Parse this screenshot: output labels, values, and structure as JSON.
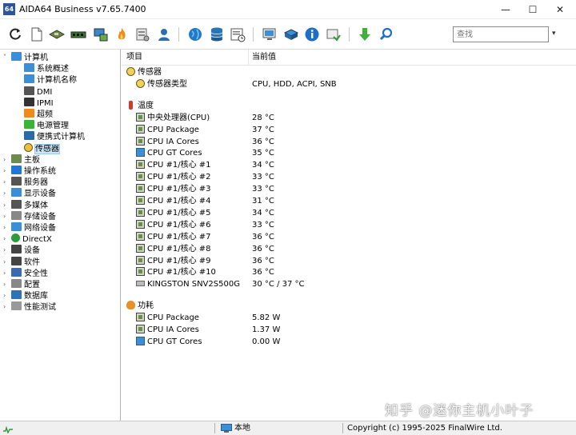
{
  "window": {
    "app_icon_text": "64",
    "title": "AIDA64 Business v7.65.7400",
    "min_glyph": "—",
    "max_glyph": "☐",
    "close_glyph": "✕"
  },
  "toolbar": {
    "icons": [
      "refresh-icon",
      "report-icon",
      "motherboard-icon",
      "memory-icon",
      "network-icon",
      "flame-icon",
      "benchmark-icon",
      "user-icon",
      "globe-icon",
      "database-icon",
      "schedule-icon",
      "monitor-diagnostics-icon",
      "network-audit-icon",
      "info-icon",
      "cpuid-icon",
      "download-icon",
      "search-icon"
    ],
    "search_placeholder": "查找",
    "search_value": "",
    "dropdown_glyph": "▾"
  },
  "tree": {
    "items": [
      {
        "label": "计算机",
        "depth": 0,
        "expand": "open",
        "icon": "computer-icon"
      },
      {
        "label": "系统概述",
        "depth": 1,
        "expand": "",
        "icon": "monitor-icon"
      },
      {
        "label": "计算机名称",
        "depth": 1,
        "expand": "",
        "icon": "monitor-icon"
      },
      {
        "label": "DMI",
        "depth": 1,
        "expand": "",
        "icon": "dmi-icon"
      },
      {
        "label": "IPMI",
        "depth": 1,
        "expand": "",
        "icon": "ipmi-icon"
      },
      {
        "label": "超频",
        "depth": 1,
        "expand": "",
        "icon": "flame-icon"
      },
      {
        "label": "电源管理",
        "depth": 1,
        "expand": "",
        "icon": "power-icon"
      },
      {
        "label": "便携式计算机",
        "depth": 1,
        "expand": "",
        "icon": "laptop-icon"
      },
      {
        "label": "传感器",
        "depth": 1,
        "expand": "",
        "icon": "sensor-icon",
        "selected": true
      },
      {
        "label": "主板",
        "depth": 0,
        "expand": "closed",
        "icon": "motherboard-icon"
      },
      {
        "label": "操作系统",
        "depth": 0,
        "expand": "closed",
        "icon": "windows-icon"
      },
      {
        "label": "服务器",
        "depth": 0,
        "expand": "closed",
        "icon": "server-icon"
      },
      {
        "label": "显示设备",
        "depth": 0,
        "expand": "closed",
        "icon": "display-icon"
      },
      {
        "label": "多媒体",
        "depth": 0,
        "expand": "closed",
        "icon": "speaker-icon"
      },
      {
        "label": "存储设备",
        "depth": 0,
        "expand": "closed",
        "icon": "storage-icon"
      },
      {
        "label": "网络设备",
        "depth": 0,
        "expand": "closed",
        "icon": "network-icon"
      },
      {
        "label": "DirectX",
        "depth": 0,
        "expand": "closed",
        "icon": "xbox-icon"
      },
      {
        "label": "设备",
        "depth": 0,
        "expand": "closed",
        "icon": "device-icon"
      },
      {
        "label": "软件",
        "depth": 0,
        "expand": "closed",
        "icon": "software-icon"
      },
      {
        "label": "安全性",
        "depth": 0,
        "expand": "closed",
        "icon": "shield-icon"
      },
      {
        "label": "配置",
        "depth": 0,
        "expand": "closed",
        "icon": "config-icon"
      },
      {
        "label": "数据库",
        "depth": 0,
        "expand": "closed",
        "icon": "database-icon"
      },
      {
        "label": "性能测试",
        "depth": 0,
        "expand": "closed",
        "icon": "benchmark-icon"
      }
    ]
  },
  "list": {
    "col_item": "项目",
    "col_value": "当前值",
    "rows": [
      {
        "kind": "group",
        "key": "传感器",
        "value": "",
        "icon": "gauge-icon"
      },
      {
        "kind": "item",
        "key": "传感器类型",
        "value": "CPU, HDD, ACPI, SNB",
        "icon": "gauge-icon"
      },
      {
        "kind": "gap"
      },
      {
        "kind": "group",
        "key": "温度",
        "value": "",
        "icon": "thermometer-icon"
      },
      {
        "kind": "item",
        "key": "中央处理器(CPU)",
        "value": "28 °C",
        "icon": "chip-icon"
      },
      {
        "kind": "item",
        "key": "CPU Package",
        "value": "37 °C",
        "icon": "chip-icon"
      },
      {
        "kind": "item",
        "key": "CPU IA Cores",
        "value": "36 °C",
        "icon": "chip-icon"
      },
      {
        "kind": "item",
        "key": "CPU GT Cores",
        "value": "35 °C",
        "icon": "gpu-monitor-icon"
      },
      {
        "kind": "item",
        "key": "CPU #1/核心 #1",
        "value": "34 °C",
        "icon": "chip-icon"
      },
      {
        "kind": "item",
        "key": "CPU #1/核心 #2",
        "value": "33 °C",
        "icon": "chip-icon"
      },
      {
        "kind": "item",
        "key": "CPU #1/核心 #3",
        "value": "33 °C",
        "icon": "chip-icon"
      },
      {
        "kind": "item",
        "key": "CPU #1/核心 #4",
        "value": "31 °C",
        "icon": "chip-icon"
      },
      {
        "kind": "item",
        "key": "CPU #1/核心 #5",
        "value": "34 °C",
        "icon": "chip-icon"
      },
      {
        "kind": "item",
        "key": "CPU #1/核心 #6",
        "value": "33 °C",
        "icon": "chip-icon"
      },
      {
        "kind": "item",
        "key": "CPU #1/核心 #7",
        "value": "36 °C",
        "icon": "chip-icon"
      },
      {
        "kind": "item",
        "key": "CPU #1/核心 #8",
        "value": "36 °C",
        "icon": "chip-icon"
      },
      {
        "kind": "item",
        "key": "CPU #1/核心 #9",
        "value": "36 °C",
        "icon": "chip-icon"
      },
      {
        "kind": "item",
        "key": "CPU #1/核心 #10",
        "value": "36 °C",
        "icon": "chip-icon"
      },
      {
        "kind": "item",
        "key": "KINGSTON SNV2S500G",
        "value": "30 °C / 37 °C",
        "icon": "disk-icon"
      },
      {
        "kind": "gap"
      },
      {
        "kind": "group",
        "key": "功耗",
        "value": "",
        "icon": "power-flame-icon"
      },
      {
        "kind": "item",
        "key": "CPU Package",
        "value": "5.82 W",
        "icon": "chip-icon"
      },
      {
        "kind": "item",
        "key": "CPU IA Cores",
        "value": "1.37 W",
        "icon": "chip-icon"
      },
      {
        "kind": "item",
        "key": "CPU GT Cores",
        "value": "0.00 W",
        "icon": "gpu-monitor-icon"
      }
    ]
  },
  "status": {
    "left_icon": "status-activity-icon",
    "local_label": "本地",
    "copyright": "Copyright (c) 1995-2025 FinalWire Ltd."
  },
  "watermark": "知乎 @迷你主机小叶子",
  "colors": {
    "selection": "#cce4f7",
    "accent_blue": "#2b579a"
  }
}
